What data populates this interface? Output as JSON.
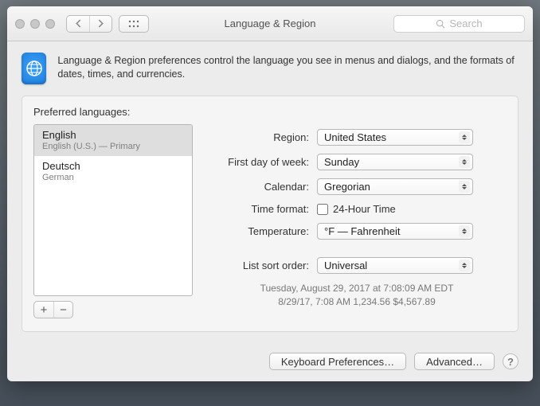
{
  "window": {
    "title": "Language & Region"
  },
  "search": {
    "placeholder": "Search"
  },
  "intro": "Language & Region preferences control the language you see in menus and dialogs, and the formats of dates, times, and currencies.",
  "languages": {
    "label": "Preferred languages:",
    "items": [
      {
        "name": "English",
        "sub": "English (U.S.) — Primary"
      },
      {
        "name": "Deutsch",
        "sub": "German"
      }
    ]
  },
  "form": {
    "region": {
      "label": "Region:",
      "value": "United States"
    },
    "first_day": {
      "label": "First day of week:",
      "value": "Sunday"
    },
    "calendar": {
      "label": "Calendar:",
      "value": "Gregorian"
    },
    "time_format": {
      "label": "Time format:",
      "chk_label": "24-Hour Time"
    },
    "temperature": {
      "label": "Temperature:",
      "value": "°F — Fahrenheit"
    },
    "list_sort": {
      "label": "List sort order:",
      "value": "Universal"
    }
  },
  "examples": {
    "line1": "Tuesday, August 29, 2017 at 7:08:09 AM EDT",
    "line2": "8/29/17, 7:08 AM    1,234.56    $4,567.89"
  },
  "footer": {
    "keyboard": "Keyboard Preferences…",
    "advanced": "Advanced…"
  }
}
